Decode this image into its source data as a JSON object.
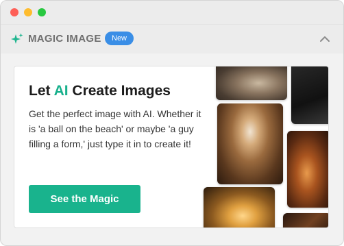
{
  "header": {
    "title": "MAGIC IMAGE",
    "badge": "New"
  },
  "card": {
    "title_prefix": "Let ",
    "title_accent": "AI",
    "title_suffix": " Create Images",
    "description": "Get the perfect image with AI. Whether it is 'a ball on the beach' or maybe 'a guy filling a form,' just type it in to create it!",
    "cta_label": "See the Magic"
  },
  "icons": [
    "sparkle-icon",
    "chevron-up-icon"
  ],
  "colors": {
    "accent": "#19b38d",
    "badge": "#3a8ee6"
  }
}
